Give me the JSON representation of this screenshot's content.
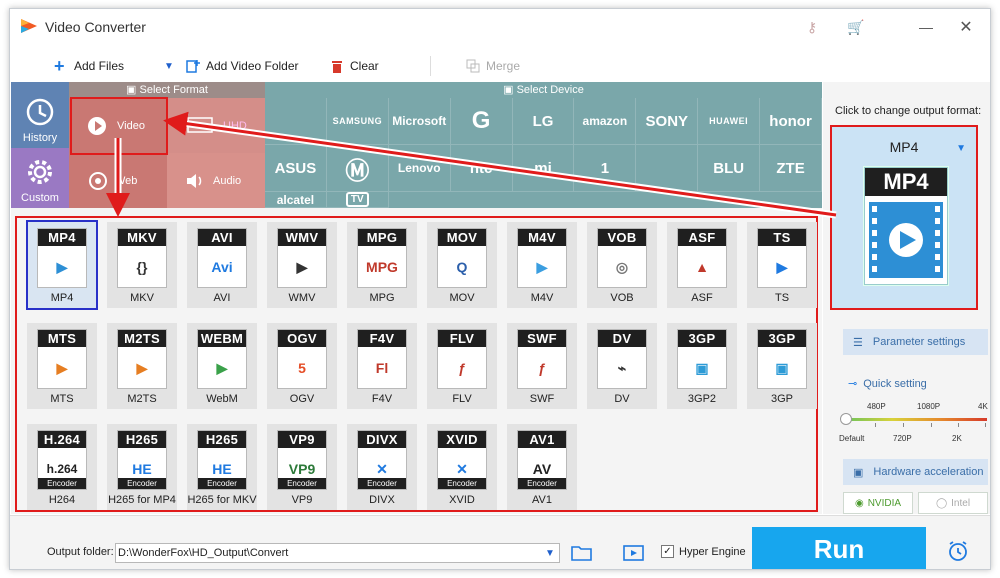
{
  "window": {
    "title": "Video Converter"
  },
  "toolbar": {
    "add_files": "Add Files",
    "add_folder": "Add Video Folder",
    "clear": "Clear",
    "merge": "Merge"
  },
  "format_bar": {
    "select_format": "Select Format",
    "select_device": "Select Device"
  },
  "side": {
    "history": "History",
    "custom": "Custom"
  },
  "categories": {
    "video": "Video",
    "uhd": "UHD",
    "web": "Web",
    "audio": "Audio"
  },
  "devices": [
    "",
    "SAMSUNG",
    "Microsoft",
    "G",
    "LG",
    "amazon",
    "SONY",
    "HUAWEI",
    "honor",
    "ASUS",
    "",
    "Lenovo",
    "htc",
    "mi",
    "1",
    "",
    "BLU",
    "ZTE",
    "alcatel",
    "TV"
  ],
  "formats": [
    {
      "band": "MP4",
      "name": "MP4",
      "selected": true
    },
    {
      "band": "MKV",
      "name": "MKV"
    },
    {
      "band": "AVI",
      "name": "AVI"
    },
    {
      "band": "WMV",
      "name": "WMV"
    },
    {
      "band": "MPG",
      "name": "MPG"
    },
    {
      "band": "MOV",
      "name": "MOV"
    },
    {
      "band": "M4V",
      "name": "M4V"
    },
    {
      "band": "VOB",
      "name": "VOB"
    },
    {
      "band": "ASF",
      "name": "ASF"
    },
    {
      "band": "TS",
      "name": "TS"
    },
    {
      "band": "MTS",
      "name": "MTS"
    },
    {
      "band": "M2TS",
      "name": "M2TS"
    },
    {
      "band": "WEBM",
      "name": "WebM"
    },
    {
      "band": "OGV",
      "name": "OGV"
    },
    {
      "band": "F4V",
      "name": "F4V"
    },
    {
      "band": "FLV",
      "name": "FLV"
    },
    {
      "band": "SWF",
      "name": "SWF"
    },
    {
      "band": "DV",
      "name": "DV"
    },
    {
      "band": "3GP",
      "name": "3GP2"
    },
    {
      "band": "3GP",
      "name": "3GP"
    },
    {
      "band": "H.264",
      "name": "H264",
      "enc": "Encoder"
    },
    {
      "band": "H265",
      "name": "H265 for MP4",
      "enc": "Encoder"
    },
    {
      "band": "H265",
      "name": "H265 for MKV",
      "enc": "Encoder"
    },
    {
      "band": "VP9",
      "name": "VP9",
      "enc": "Encoder"
    },
    {
      "band": "DIVX",
      "name": "DIVX",
      "enc": "Encoder"
    },
    {
      "band": "XVID",
      "name": "XVID",
      "enc": "Encoder"
    },
    {
      "band": "AV1",
      "name": "AV1",
      "enc": "Encoder"
    }
  ],
  "right": {
    "hint": "Click to change output format:",
    "output_format": "MP4",
    "param_settings": "Parameter settings",
    "quick_setting": "Quick setting",
    "slider_top": [
      "480P",
      "1080P",
      "4K"
    ],
    "slider_bottom": [
      "Default",
      "720P",
      "2K"
    ],
    "quick_level": 0,
    "hw_accel": "Hardware acceleration",
    "nvidia": "NVIDIA",
    "intel": "Intel"
  },
  "bottom": {
    "output_folder_label": "Output folder:",
    "output_path": "D:\\WonderFox\\HD_Output\\Convert",
    "hyper_engine": "Hyper Engine",
    "hyper_checked": true,
    "run": "Run"
  },
  "colors": {
    "accent": "#17a6ee",
    "annotation_red": "#e01b1b",
    "selection_blue": "#2830c8"
  }
}
